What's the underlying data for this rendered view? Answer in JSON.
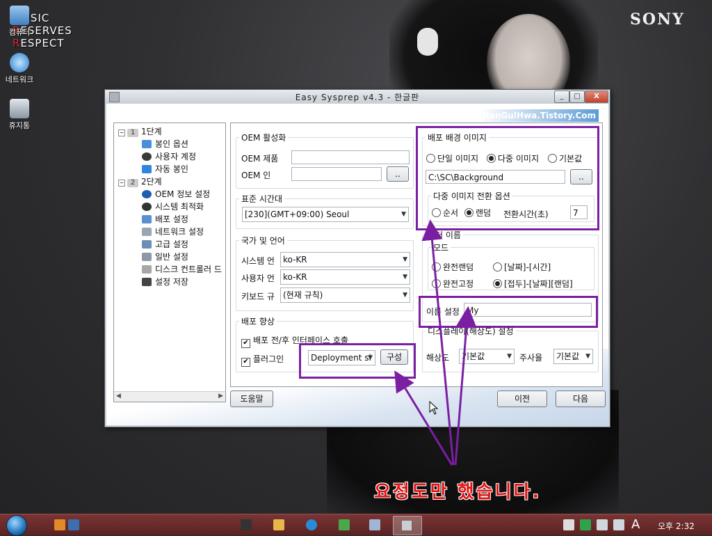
{
  "desktop": {
    "brand": "SONY",
    "logo_lines": [
      "USIC",
      "ESERVES",
      "ESPECT"
    ],
    "logo_initials": [
      "M",
      "R",
      "R"
    ],
    "icons": [
      {
        "name": "computer-icon",
        "label": "컴퓨터"
      },
      {
        "name": "network-icon",
        "label": "네트워크"
      },
      {
        "name": "recycle-bin-icon",
        "label": "휴지통"
      }
    ]
  },
  "window": {
    "title": "Easy Sysprep v4.3 - 한글판",
    "header_link": "HanGulHwa.Tistory.Com",
    "controls": {
      "minimize": "_",
      "maximize": "□",
      "close": "X"
    }
  },
  "tree": {
    "stage1": {
      "num": "1",
      "label": "1단계",
      "children": [
        "봉인 옵션",
        "사용자 계정",
        "자동 봉인"
      ]
    },
    "stage2": {
      "num": "2",
      "label": "2단계",
      "children": [
        "OEM 정보 설정",
        "시스템 최적화",
        "배포 설정",
        "네트워크 설정",
        "고급 설정",
        "일반 설정",
        "디스크 컨트롤러 드",
        "설정 저장"
      ]
    }
  },
  "oem": {
    "legend": "OEM 활성화",
    "product_label": "OEM 제품",
    "product_value": "",
    "logo_label": "OEM 인",
    "logo_value": "",
    "browse": ".."
  },
  "timezone": {
    "legend": "표준 시간대",
    "value": "[230](GMT+09:00) Seoul"
  },
  "locale": {
    "legend": "국가 및 언어",
    "system_label": "시스템 언",
    "system_value": "ko-KR",
    "user_label": "사용자 언",
    "user_value": "ko-KR",
    "keyboard_label": "키보드 규",
    "keyboard_value": "(현재 규칙)"
  },
  "deploy": {
    "legend": "배포 향상",
    "interface_label": "배포 전/후 인터페이스 호출",
    "interface_checked": true,
    "plugin_label": "플러그인",
    "plugin_checked": true,
    "plugin_value": "Deployment si",
    "config_button": "구성"
  },
  "background": {
    "legend": "배포 배경 이미지",
    "options": [
      "단일 이미지",
      "다중 이미지",
      "기본값"
    ],
    "selected": "다중 이미지",
    "path": "C:\\SC\\Background",
    "browse": "..",
    "multi_legend": "다중 이미지 전환 옵션",
    "order_options": [
      "순서",
      "랜덤"
    ],
    "order_selected": "랜덤",
    "interval_label": "전환시간(초)",
    "interval_value": "7"
  },
  "computer_name": {
    "legend": "퓨터 이름",
    "mode_legend": "모드",
    "modes": [
      "완전랜덤",
      "[날짜]-[시간]",
      "완전고정",
      "[접두]-[날짜][랜덤]"
    ],
    "mode_selected": "[접두]-[날짜][랜덤]",
    "name_label": "이름 설정",
    "name_value": "My"
  },
  "display": {
    "legend": "디스플레이(해상도) 설정",
    "resolution_label": "해상도",
    "resolution_value": "기본값",
    "refresh_label": "주사율",
    "refresh_value": "기본값"
  },
  "buttons": {
    "help": "도움말",
    "prev": "이전",
    "next": "다음"
  },
  "annotation": "요정도만 했습니다.",
  "annotation_color": "#e01414",
  "highlight_color": "#7b1fa2",
  "taskbar": {
    "clock": "오후 2:32",
    "ime": "A"
  }
}
